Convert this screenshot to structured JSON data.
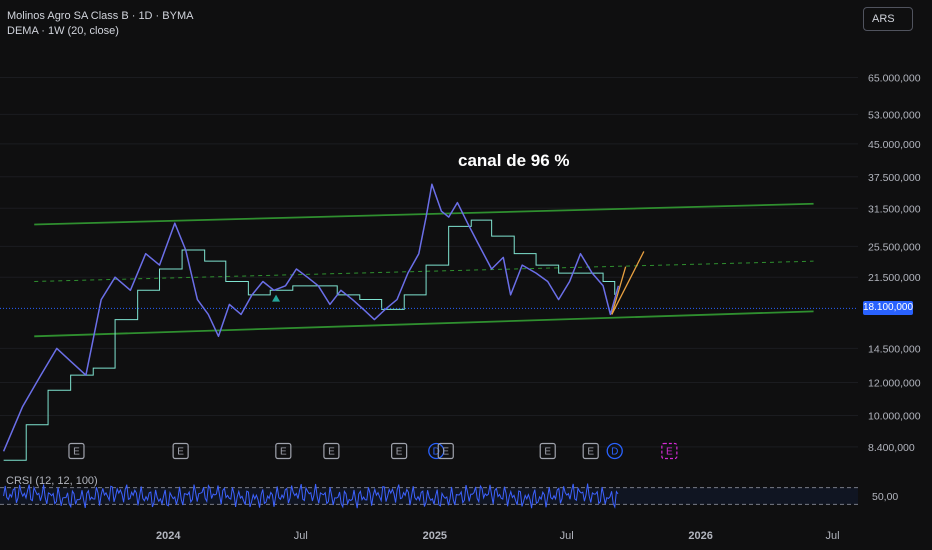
{
  "legend": {
    "symbol": "Molinos Agro SA Class B · 1D · BYMA",
    "indicator": "DEMA · 1W (20, close)"
  },
  "currency_button": "ARS",
  "last_price": "18.100,000",
  "crsi_label": "CRSI (12, 12, 100)",
  "colors": {
    "background": "#0f0f10",
    "price_line": "#6b6fe8",
    "dema_line": "#7fe3d0",
    "channel": "#2f8f2f",
    "projection": "#e8a040",
    "last_price": "#2962ff",
    "dividend": "#2962ff",
    "earnings": "#a0a3ad",
    "future_earnings": "#d62bd6",
    "crsi_line": "#3d62ff"
  },
  "chart_data": {
    "type": "line",
    "title": "",
    "annotation": "canal de 96 %",
    "y_scale": "log",
    "ylim": [
      7600000,
      80000000
    ],
    "y_ticks": [
      {
        "value": 65000000,
        "label": "65.000,000"
      },
      {
        "value": 53000000,
        "label": "53.000,000"
      },
      {
        "value": 45000000,
        "label": "45.000,000"
      },
      {
        "value": 37500000,
        "label": "37.500,000"
      },
      {
        "value": 31500000,
        "label": "31.500,000"
      },
      {
        "value": 25500000,
        "label": "25.500,000"
      },
      {
        "value": 21500000,
        "label": "21.500,000"
      },
      {
        "value": 14500000,
        "label": "14.500,000"
      },
      {
        "value": 12000000,
        "label": "12.000,000"
      },
      {
        "value": 10000000,
        "label": "10.000,000"
      },
      {
        "value": 8400000,
        "label": "8.400,000"
      }
    ],
    "xlim": [
      "2023-05-15",
      "2026-08-05"
    ],
    "x_ticks": [
      {
        "date": "2024-01-01",
        "label": "2024"
      },
      {
        "date": "2024-07-01",
        "label": "Jul"
      },
      {
        "date": "2025-01-01",
        "label": "2025"
      },
      {
        "date": "2025-07-01",
        "label": "Jul"
      },
      {
        "date": "2026-01-01",
        "label": "2026"
      },
      {
        "date": "2026-07-01",
        "label": "Jul"
      }
    ],
    "series": [
      {
        "key": "price",
        "points": [
          [
            "2023-05-20",
            8200000
          ],
          [
            "2023-06-15",
            10500000
          ],
          [
            "2023-07-10",
            12500000
          ],
          [
            "2023-08-01",
            14500000
          ],
          [
            "2023-08-20",
            13500000
          ],
          [
            "2023-09-10",
            12500000
          ],
          [
            "2023-10-01",
            19000000
          ],
          [
            "2023-10-20",
            21500000
          ],
          [
            "2023-11-10",
            20000000
          ],
          [
            "2023-12-01",
            24500000
          ],
          [
            "2023-12-20",
            23000000
          ],
          [
            "2024-01-10",
            29000000
          ],
          [
            "2024-01-25",
            25000000
          ],
          [
            "2024-02-10",
            19000000
          ],
          [
            "2024-02-25",
            17500000
          ],
          [
            "2024-03-10",
            15500000
          ],
          [
            "2024-03-25",
            18500000
          ],
          [
            "2024-04-10",
            17500000
          ],
          [
            "2024-04-25",
            19500000
          ],
          [
            "2024-05-10",
            21000000
          ],
          [
            "2024-05-25",
            20000000
          ],
          [
            "2024-06-10",
            20500000
          ],
          [
            "2024-06-25",
            22500000
          ],
          [
            "2024-07-10",
            21500000
          ],
          [
            "2024-07-25",
            20500000
          ],
          [
            "2024-08-10",
            18500000
          ],
          [
            "2024-08-25",
            20000000
          ],
          [
            "2024-09-10",
            19000000
          ],
          [
            "2024-09-25",
            18000000
          ],
          [
            "2024-10-10",
            17000000
          ],
          [
            "2024-10-25",
            18000000
          ],
          [
            "2024-11-10",
            19000000
          ],
          [
            "2024-11-25",
            22000000
          ],
          [
            "2024-12-10",
            24500000
          ],
          [
            "2024-12-20",
            30000000
          ],
          [
            "2024-12-28",
            36000000
          ],
          [
            "2025-01-10",
            31000000
          ],
          [
            "2025-01-20",
            30000000
          ],
          [
            "2025-02-01",
            32500000
          ],
          [
            "2025-02-15",
            29000000
          ],
          [
            "2025-03-01",
            26000000
          ],
          [
            "2025-03-20",
            22500000
          ],
          [
            "2025-04-05",
            24000000
          ],
          [
            "2025-04-15",
            19500000
          ],
          [
            "2025-05-01",
            23000000
          ],
          [
            "2025-05-20",
            22000000
          ],
          [
            "2025-06-05",
            21000000
          ],
          [
            "2025-06-20",
            19000000
          ],
          [
            "2025-07-05",
            21000000
          ],
          [
            "2025-07-20",
            24500000
          ],
          [
            "2025-08-05",
            22000000
          ],
          [
            "2025-08-20",
            20500000
          ],
          [
            "2025-08-30",
            17500000
          ],
          [
            "2025-09-10",
            20500000
          ]
        ]
      },
      {
        "key": "dema",
        "points": [
          [
            "2023-05-20",
            7800000
          ],
          [
            "2023-06-20",
            9500000
          ],
          [
            "2023-07-20",
            11500000
          ],
          [
            "2023-08-20",
            12500000
          ],
          [
            "2023-09-20",
            13000000
          ],
          [
            "2023-10-20",
            17000000
          ],
          [
            "2023-11-20",
            20000000
          ],
          [
            "2023-12-20",
            22500000
          ],
          [
            "2024-01-20",
            25000000
          ],
          [
            "2024-02-20",
            23500000
          ],
          [
            "2024-03-20",
            21000000
          ],
          [
            "2024-04-20",
            19500000
          ],
          [
            "2024-05-20",
            20000000
          ],
          [
            "2024-06-20",
            20500000
          ],
          [
            "2024-07-20",
            20500000
          ],
          [
            "2024-08-20",
            19500000
          ],
          [
            "2024-09-20",
            19000000
          ],
          [
            "2024-10-20",
            18000000
          ],
          [
            "2024-11-20",
            19500000
          ],
          [
            "2024-12-20",
            23000000
          ],
          [
            "2025-01-20",
            28500000
          ],
          [
            "2025-02-20",
            29500000
          ],
          [
            "2025-03-20",
            27000000
          ],
          [
            "2025-04-20",
            24500000
          ],
          [
            "2025-05-20",
            23000000
          ],
          [
            "2025-06-20",
            22000000
          ],
          [
            "2025-07-20",
            22000000
          ],
          [
            "2025-08-20",
            21000000
          ],
          [
            "2025-09-05",
            19500000
          ]
        ]
      }
    ],
    "channel": {
      "upper": [
        [
          "2023-07-01",
          28800000
        ],
        [
          "2026-06-05",
          32300000
        ]
      ],
      "mid": [
        [
          "2023-07-01",
          21000000
        ],
        [
          "2026-06-05",
          23500000
        ]
      ],
      "lower": [
        [
          "2023-07-01",
          15500000
        ],
        [
          "2026-06-05",
          17800000
        ]
      ]
    },
    "projections": [
      [
        [
          "2025-09-01",
          17500000
        ],
        [
          "2025-10-15",
          24800000
        ]
      ],
      [
        [
          "2025-09-01",
          17500000
        ],
        [
          "2025-09-20",
          22800000
        ]
      ]
    ],
    "last_price_value": 18100000,
    "events": [
      {
        "date": "2023-08-28",
        "kind": "E"
      },
      {
        "date": "2024-01-18",
        "kind": "E"
      },
      {
        "date": "2024-06-07",
        "kind": "E"
      },
      {
        "date": "2024-08-12",
        "kind": "E"
      },
      {
        "date": "2024-11-13",
        "kind": "E"
      },
      {
        "date": "2025-01-03",
        "kind": "D"
      },
      {
        "date": "2025-01-16",
        "kind": "E"
      },
      {
        "date": "2025-06-05",
        "kind": "E"
      },
      {
        "date": "2025-08-03",
        "kind": "E"
      },
      {
        "date": "2025-09-05",
        "kind": "D"
      },
      {
        "date": "2025-11-19",
        "kind": "E",
        "future": true
      }
    ],
    "markers": [
      {
        "date": "2024-05-28",
        "value": 19100000,
        "shape": "triangle-up"
      }
    ],
    "crsi": {
      "ylim": [
        0,
        100
      ],
      "bands": [
        20,
        80
      ],
      "tick": {
        "value": 50,
        "label": "50,00"
      }
    }
  }
}
